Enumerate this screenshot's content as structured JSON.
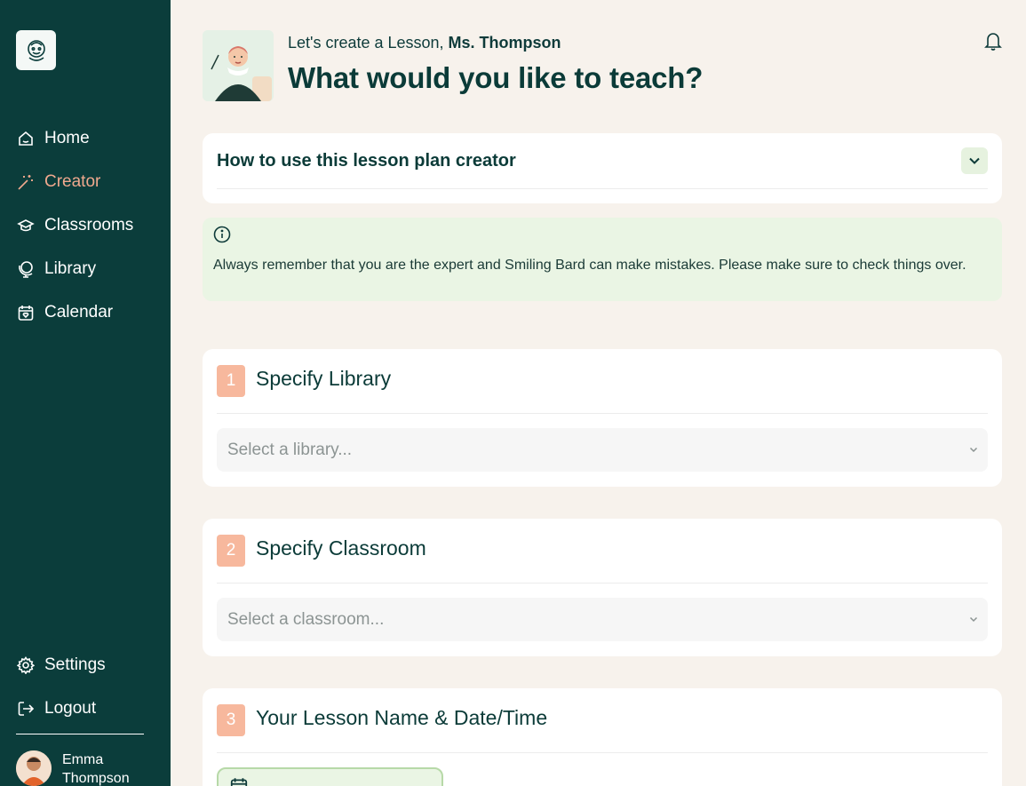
{
  "sidebar": {
    "nav": [
      {
        "label": "Home",
        "icon": "home-icon"
      },
      {
        "label": "Creator",
        "icon": "magic-wand-icon",
        "active": true
      },
      {
        "label": "Classrooms",
        "icon": "graduation-cap-icon"
      },
      {
        "label": "Library",
        "icon": "globe-icon"
      },
      {
        "label": "Calendar",
        "icon": "calendar-icon"
      }
    ],
    "bottom": [
      {
        "label": "Settings",
        "icon": "gear-icon"
      },
      {
        "label": "Logout",
        "icon": "logout-icon"
      }
    ],
    "user": {
      "name": "Emma Thompson"
    }
  },
  "header": {
    "greeting_prefix": "Let's create a Lesson, ",
    "greeting_name": "Ms. Thompson",
    "headline": "What would you like to teach?"
  },
  "howto": {
    "title": "How to use this lesson plan creator"
  },
  "notice": {
    "text": "Always remember that you are the expert and Smiling Bard can make mistakes. Please make sure to check things over."
  },
  "steps": [
    {
      "number": "1",
      "title": "Specify Library",
      "placeholder": "Select a library..."
    },
    {
      "number": "2",
      "title": "Specify Classroom",
      "placeholder": "Select a classroom..."
    },
    {
      "number": "3",
      "title": "Your Lesson Name & Date/Time"
    }
  ],
  "colors": {
    "sidebar_bg": "#0b3d3b",
    "accent": "#f0a98e",
    "step_badge": "#f7b89d",
    "notice_bg": "#eaf5e4",
    "page_bg": "#f7f2ec"
  }
}
